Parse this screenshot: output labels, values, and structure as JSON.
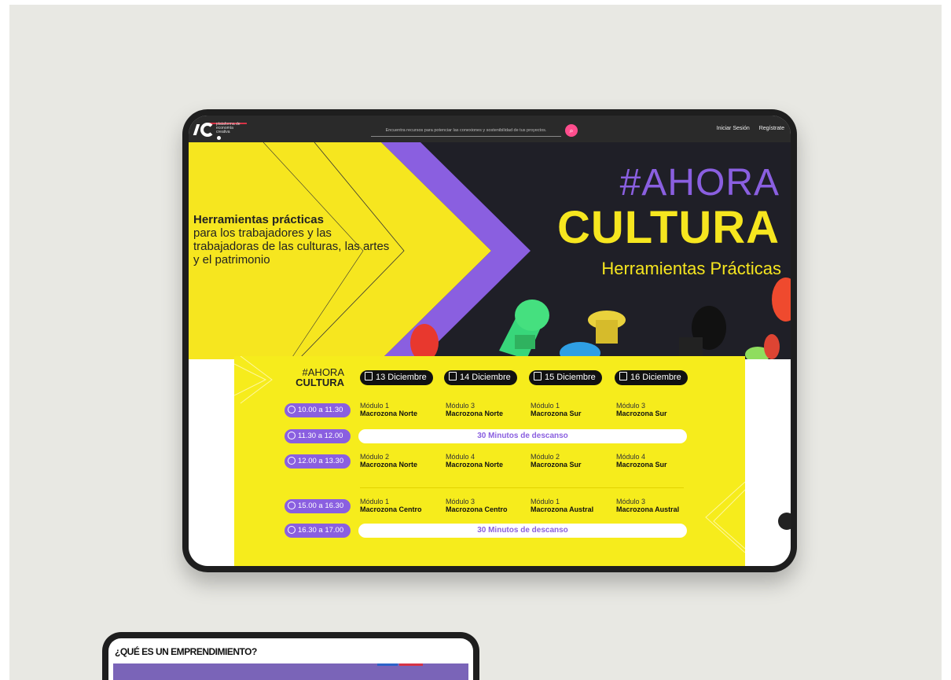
{
  "nav": {
    "logo_text": "plataforma de economía creativa",
    "search_placeholder": "Encuentra recursos para potenciar las conexiones y sostenibilidad de tus proyectos.",
    "login": "Iniciar Sesión",
    "register": "Regístrate"
  },
  "hero": {
    "lead_bold": "Herramientas prácticas",
    "lead_text": "para los trabajadores y las trabajadoras de las culturas, las artes y el patrimonio",
    "title_line1": "#AHORA",
    "title_line2": "CULTURA",
    "subtitle": "Herramientas Prácticas"
  },
  "schedule": {
    "logo_line1": "#AHORA",
    "logo_line2": "CULTURA",
    "days": [
      "13 Diciembre",
      "14 Diciembre",
      "15 Diciembre",
      "16 Diciembre"
    ],
    "rows": [
      {
        "time": "10.00 a 11.30",
        "cells": [
          [
            "Módulo 1",
            "Macrozona Norte"
          ],
          [
            "Módulo 3",
            "Macrozona Norte"
          ],
          [
            "Módulo 1",
            "Macrozona Sur"
          ],
          [
            "Módulo 3",
            "Macrozona Sur"
          ]
        ]
      },
      {
        "time": "11.30 a 12.00",
        "break": "30 Minutos de descanso"
      },
      {
        "time": "12.00 a 13.30",
        "cells": [
          [
            "Módulo 2",
            "Macrozona Norte"
          ],
          [
            "Módulo 4",
            "Macrozona Norte"
          ],
          [
            "Módulo 2",
            "Macrozona Sur"
          ],
          [
            "Módulo 4",
            "Macrozona Sur"
          ]
        ]
      },
      {
        "time": "15.00 a 16.30",
        "cells": [
          [
            "Módulo 1",
            "Macrozona Centro"
          ],
          [
            "Módulo 3",
            "Macrozona Centro"
          ],
          [
            "Módulo 1",
            "Macrozona Austral"
          ],
          [
            "Módulo 3",
            "Macrozona Austral"
          ]
        ]
      },
      {
        "time": "16.30 a 17.00",
        "break": "30 Minutos de descanso"
      }
    ]
  },
  "second_screen": {
    "heading": "¿QUÉ ES UN EMPRENDIMIENTO?"
  },
  "colors": {
    "yellow": "#f6e61f",
    "purple": "#8a5fe0",
    "search_button": "#ff4d8d",
    "dark": "#2a2a2a"
  }
}
